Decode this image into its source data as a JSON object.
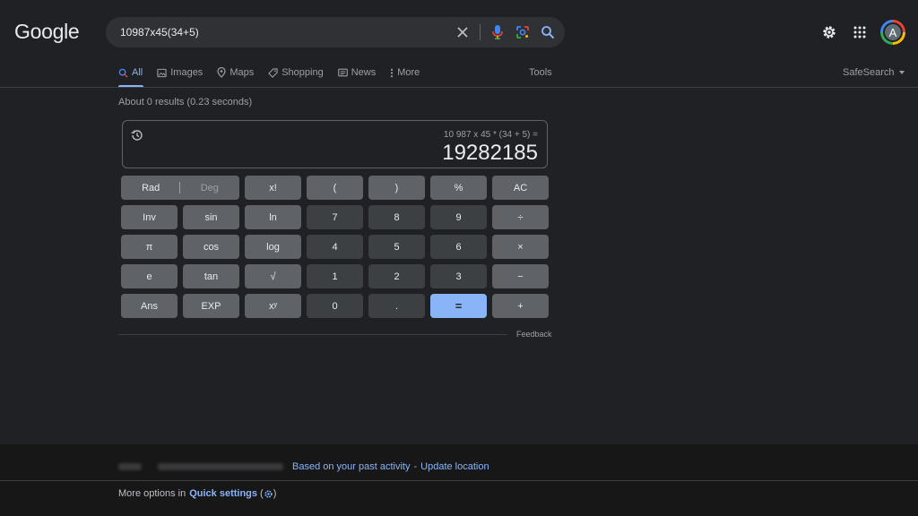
{
  "header": {
    "logo": "Google",
    "search_query": "10987x45(34+5)",
    "avatar_letter": "A"
  },
  "tabs": [
    {
      "label": "All",
      "icon": "search-icon",
      "active": true
    },
    {
      "label": "Images",
      "icon": "image-icon"
    },
    {
      "label": "Maps",
      "icon": "map-pin-icon"
    },
    {
      "label": "Shopping",
      "icon": "tag-icon"
    },
    {
      "label": "News",
      "icon": "news-icon"
    },
    {
      "label": "More",
      "icon": "more-vert-icon"
    }
  ],
  "tools_label": "Tools",
  "safesearch_label": "SafeSearch",
  "result_stats": "About 0 results (0.23 seconds)",
  "calculator": {
    "expression": "10 987 x 45 * (34 + 5) =",
    "result": "19282185",
    "rad_label": "Rad",
    "deg_label": "Deg",
    "keys": [
      [
        "x!",
        "(",
        ")",
        "%",
        "AC"
      ],
      [
        "Inv",
        "sin",
        "ln",
        "7",
        "8",
        "9",
        "÷"
      ],
      [
        "π",
        "cos",
        "log",
        "4",
        "5",
        "6",
        "×"
      ],
      [
        "e",
        "tan",
        "√",
        "1",
        "2",
        "3",
        "−"
      ],
      [
        "Ans",
        "EXP",
        "xʸ",
        "0",
        ".",
        "=",
        "+"
      ]
    ]
  },
  "feedback_label": "Feedback",
  "footer": {
    "location_text": "Based on your past activity",
    "separator": "-",
    "update_location": "Update location",
    "more_options": "More options in",
    "quick_settings": "Quick settings",
    "colors": {
      "link": "#8ab4f8",
      "background": "#202124",
      "equals": "#8ab4f8"
    }
  }
}
